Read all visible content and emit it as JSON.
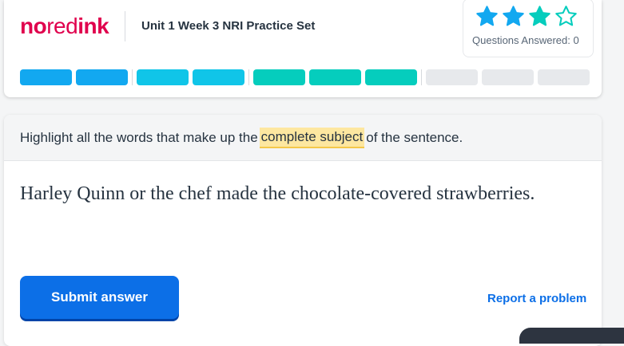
{
  "brand": {
    "part1": "no",
    "part2": "red",
    "part3": "ink"
  },
  "header": {
    "set_title": "Unit 1 Week 3 NRI Practice Set"
  },
  "stars": {
    "filled": 3,
    "total": 4,
    "questions_answered_label": "Questions Answered: 0"
  },
  "progress": {
    "groups": [
      {
        "color": "#12a8f0",
        "segments": 2,
        "completed": true
      },
      {
        "color": "#10c5e8",
        "segments": 2,
        "completed": true
      },
      {
        "color": "#05cdbd",
        "segments": 3,
        "completed": true
      },
      {
        "color": "#e7e9ec",
        "segments": 3,
        "completed": false
      }
    ]
  },
  "question": {
    "instruction_before": "Highlight all the words that make up the",
    "instruction_highlight": "complete subject",
    "instruction_after": "of the sentence.",
    "sentence": "Harley Quinn or the chef made the chocolate-covered strawberries."
  },
  "actions": {
    "submit_label": "Submit answer",
    "report_label": "Report a problem"
  },
  "colors": {
    "brand": "#e0004d",
    "primary": "#0c6fe7",
    "star_filled_blue": "#12a8f0",
    "star_filled_green": "#05cdbd"
  }
}
